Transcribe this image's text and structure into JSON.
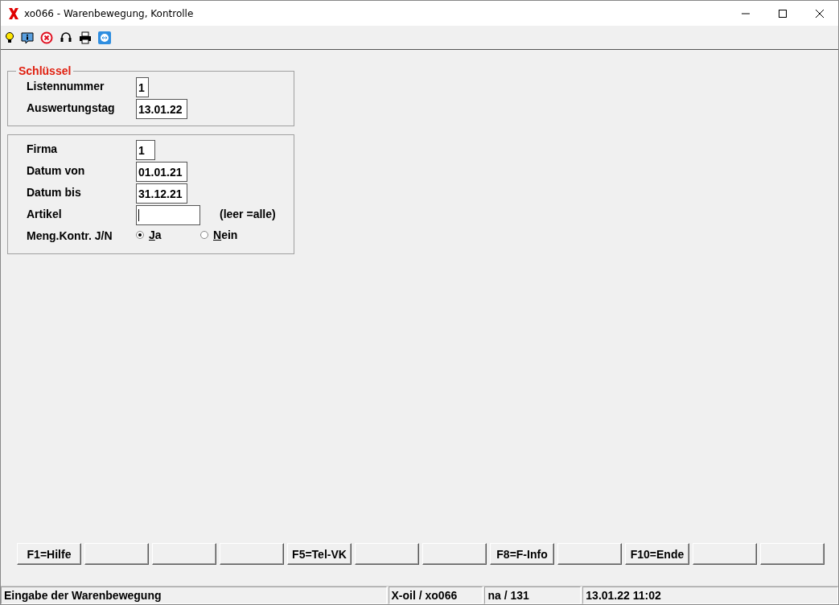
{
  "window": {
    "title": "xo066 - Warenbewegung, Kontrolle"
  },
  "key_group": {
    "title": "Schlüssel",
    "fields": [
      {
        "label": "Listennummer",
        "value": "1"
      },
      {
        "label": "Auswertungstag",
        "value": "13.01.22"
      }
    ]
  },
  "filter_group": {
    "fields": [
      {
        "kind": "text",
        "label": "Firma",
        "value": "1"
      },
      {
        "kind": "text",
        "label": "Datum von",
        "value": "01.01.21"
      },
      {
        "kind": "text",
        "label": "Datum bis",
        "value": "31.12.21"
      },
      {
        "kind": "text",
        "label": "Artikel",
        "focused": true,
        "hint": "(leer =alle)"
      },
      {
        "kind": "radio",
        "label": "Meng.Kontr. J/N",
        "options": [
          {
            "label": "Ja",
            "selected": true
          },
          {
            "label": "Nein",
            "selected": false
          }
        ]
      }
    ]
  },
  "function_keys": [
    {
      "kind": "labeled",
      "label": "F1=Hilfe"
    },
    {
      "kind": "blank"
    },
    {
      "kind": "blank"
    },
    {
      "kind": "blank"
    },
    {
      "kind": "labeled",
      "label": "F5=Tel-VK"
    },
    {
      "kind": "blank"
    },
    {
      "kind": "blank"
    },
    {
      "kind": "labeled",
      "label": "F8=F-Info"
    },
    {
      "kind": "blank"
    },
    {
      "kind": "labeled",
      "label": "F10=Ende"
    },
    {
      "kind": "blank"
    },
    {
      "kind": "blank"
    }
  ],
  "status_bar": [
    "Eingabe der Warenbewegung",
    "X-oil / xo066",
    "na / 131",
    "13.01.22 11:02"
  ]
}
